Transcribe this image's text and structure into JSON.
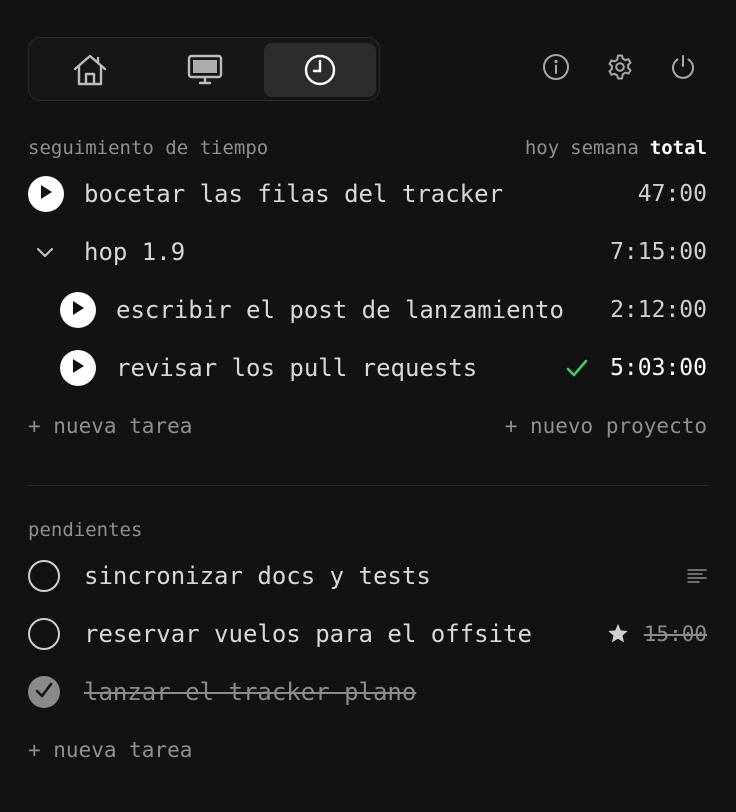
{
  "nav": {
    "tabs": [
      {
        "name": "home",
        "icon": "home-icon",
        "active": false
      },
      {
        "name": "screen",
        "icon": "monitor-icon",
        "active": false
      },
      {
        "name": "time",
        "icon": "clock-icon",
        "active": true
      }
    ],
    "actions": [
      {
        "icon": "info-icon"
      },
      {
        "icon": "gear-icon"
      },
      {
        "icon": "power-icon"
      }
    ]
  },
  "time_tracking": {
    "title": "seguimiento de tiempo",
    "ranges": [
      "hoy",
      "semana",
      "total"
    ],
    "active_range": "total",
    "task": {
      "label": "bocetar las filas del tracker",
      "time": "47:00"
    },
    "project": {
      "label": "hop 1.9",
      "time": "7:15:00",
      "expanded": true,
      "tasks": [
        {
          "label": "escribir el post de lanzamiento",
          "time": "2:12:00",
          "done": false
        },
        {
          "label": "revisar los pull requests",
          "time": "5:03:00",
          "done": true
        }
      ]
    },
    "add_task": "+ nueva tarea",
    "add_project": "+ nuevo proyecto"
  },
  "pending": {
    "title": "pendientes",
    "items": [
      {
        "label": "sincronizar docs y tests",
        "completed": false,
        "has_notes": true
      },
      {
        "label": "reservar vuelos para el offsite",
        "completed": false,
        "starred": true,
        "estimate": "15:00"
      },
      {
        "label": "lanzar el tracker plano",
        "completed": true
      }
    ],
    "add_task": "+ nueva tarea"
  },
  "colors": {
    "background": "#121212",
    "accent_check": "#3dcc5b",
    "active_tab": "#2c2c2c"
  }
}
